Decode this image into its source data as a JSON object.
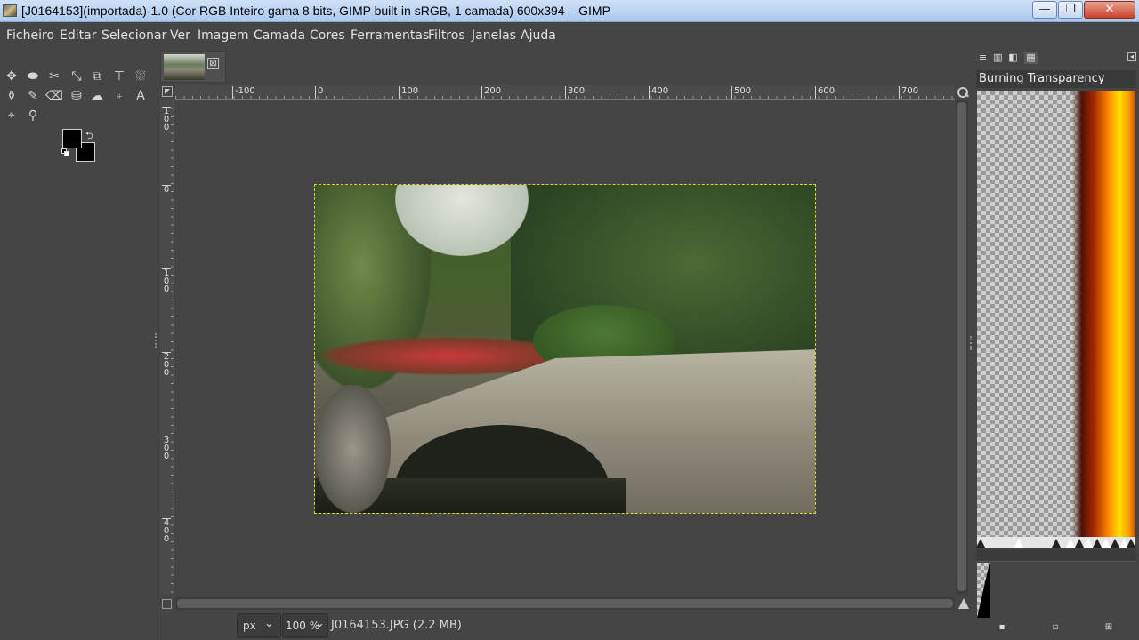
{
  "window": {
    "title": "[J0164153](importada)-1.0 (Cor RGB Inteiro gama 8 bits, GIMP built-in sRGB, 1 camada) 600x394 – GIMP",
    "minimize": "—",
    "maximize": "❐",
    "close": "✕"
  },
  "menu": {
    "items": [
      "Ficheiro",
      "Editar",
      "Selecionar",
      "Ver",
      "Imagem",
      "Camada",
      "Cores",
      "Ferramentas",
      "Filtros",
      "Janelas",
      "Ajuda"
    ]
  },
  "tools": {
    "icons": [
      "move-icon",
      "fuzzy-select-icon",
      "scissors-icon",
      "align-icon",
      "crop-icon",
      "text-transform-icon",
      "bucket-icon",
      "paint-icon",
      "brush-icon",
      "eraser-icon",
      "clone-icon",
      "smudge-icon",
      "path-icon",
      "text-icon",
      "color-picker-icon",
      "zoom-icon"
    ],
    "glyphs": [
      "✥",
      "⬬",
      "✂",
      "⤡",
      "⧉",
      "⊤",
      "⛆",
      "⚱",
      "✎",
      "⌫",
      "⛁",
      "☁",
      "⍅",
      "A",
      "⌖",
      "⚲"
    ],
    "fg_color": "#000000",
    "bg_color": "#000000"
  },
  "image_tab": {
    "close_glyph": "⊠"
  },
  "ruler": {
    "top_labels": [
      "-100",
      "0",
      "100",
      "200",
      "300",
      "400",
      "500",
      "600",
      "700"
    ],
    "left_labels": [
      "1\n0\n0",
      "0",
      "1\n0\n0",
      "2\n0\n0",
      "3\n0\n0",
      "4\n0\n0"
    ]
  },
  "status": {
    "unit": "px",
    "zoom": "100 %",
    "file_info": "J0164153.JPG (2.2 MB)",
    "chevron": "⌄"
  },
  "dock": {
    "gradient_name": "Burning Transparency",
    "tab_icons": [
      "layers-icon",
      "channels-icon",
      "gradients-icon",
      "patterns-icon"
    ],
    "tab_glyphs": [
      "≡",
      "▥",
      "◧",
      "▦"
    ],
    "menu_glyph": "◂",
    "bottom_buttons": [
      "▪",
      "▫",
      "⊞"
    ]
  },
  "colors": {
    "background": "#454545",
    "titlebar": "#aac8ee",
    "selection_outline": "#d8d830"
  }
}
